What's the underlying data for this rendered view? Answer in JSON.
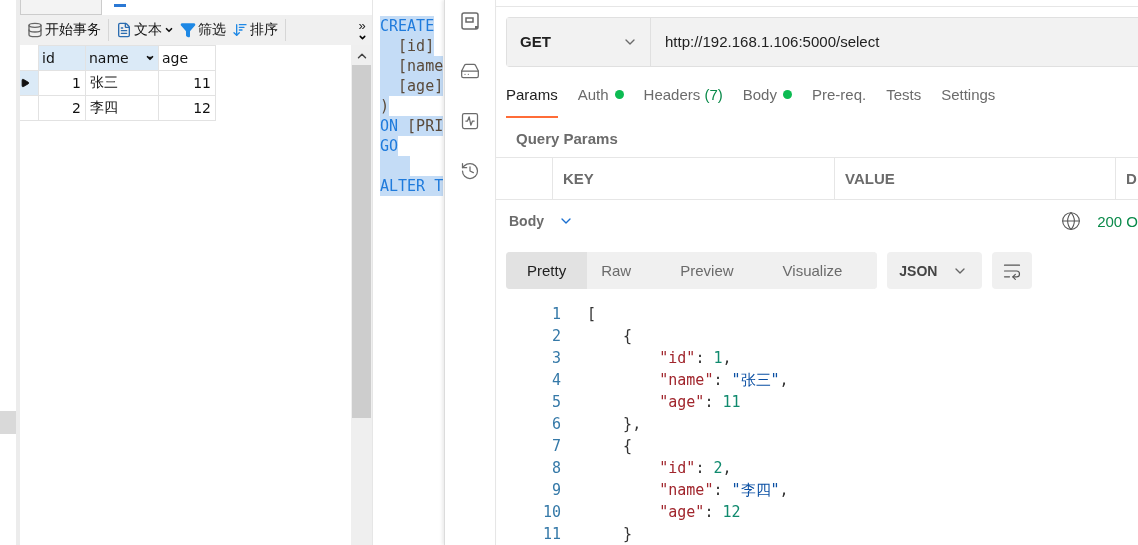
{
  "db_grid": {
    "toolbar": [
      {
        "label": "开始事务",
        "kind": "button"
      },
      {
        "label": "文本",
        "kind": "dropdown"
      },
      {
        "label": "筛选",
        "kind": "button"
      },
      {
        "label": "排序",
        "kind": "button"
      }
    ],
    "overflow": "»",
    "columns": [
      {
        "label": "id",
        "selected": true,
        "menu": false
      },
      {
        "label": "name",
        "selected": true,
        "menu": true
      },
      {
        "label": "age",
        "selected": false,
        "menu": false
      }
    ],
    "rows": [
      {
        "selected": true,
        "cells": [
          "1",
          "张三",
          "11"
        ]
      },
      {
        "selected": false,
        "cells": [
          "2",
          "李四",
          "12"
        ]
      }
    ]
  },
  "sql_editor": {
    "lines": [
      {
        "tokens": [
          {
            "kind": "keyword",
            "text": "CREATE"
          }
        ]
      },
      {
        "tokens": [
          {
            "kind": "plain",
            "text": "  [id]"
          }
        ]
      },
      {
        "tokens": [
          {
            "kind": "plain",
            "text": "  [name"
          }
        ]
      },
      {
        "tokens": [
          {
            "kind": "plain",
            "text": "  [age]"
          }
        ]
      },
      {
        "tokens": [
          {
            "kind": "plain",
            "text": ")"
          }
        ]
      },
      {
        "tokens": [
          {
            "kind": "keyword",
            "text": "ON"
          },
          {
            "kind": "plain",
            "text": " [PRI"
          }
        ]
      },
      {
        "tokens": [
          {
            "kind": "keyword",
            "text": "GO"
          }
        ]
      },
      {
        "kind": "blank"
      },
      {
        "tokens": [
          {
            "kind": "keyword",
            "text": "ALTER T"
          }
        ]
      }
    ]
  },
  "request": {
    "method": "GET",
    "url": "http://192.168.1.106:5000/select"
  },
  "tabs": [
    {
      "label": "Params",
      "selected": true,
      "dot": false
    },
    {
      "label": "Auth",
      "selected": false,
      "dot": true
    },
    {
      "label": "Headers",
      "count": "(7)",
      "selected": false,
      "dot": false
    },
    {
      "label": "Body",
      "selected": false,
      "dot": true
    },
    {
      "label": "Pre-req.",
      "selected": false,
      "dot": false
    },
    {
      "label": "Tests",
      "selected": false,
      "dot": false
    },
    {
      "label": "Settings",
      "selected": false,
      "dot": false
    }
  ],
  "query_params": {
    "title": "Query Params",
    "columns": [
      "KEY",
      "VALUE",
      "D"
    ]
  },
  "response": {
    "label": "Body",
    "status": "200 O",
    "views": [
      {
        "label": "Pretty",
        "selected": true
      },
      {
        "label": "Raw",
        "selected": false
      },
      {
        "label": "Preview",
        "selected": false
      },
      {
        "label": "Visualize",
        "selected": false
      }
    ],
    "format": "JSON",
    "lines": [
      {
        "number": "1",
        "tokens": [
          {
            "kind": "punct",
            "text": "["
          }
        ]
      },
      {
        "number": "2",
        "tokens": [
          {
            "kind": "punct",
            "text": "    {"
          }
        ]
      },
      {
        "number": "3",
        "tokens": [
          {
            "kind": "key",
            "text": "        \"id\""
          },
          {
            "kind": "punct",
            "text": ": "
          },
          {
            "kind": "number",
            "text": "1"
          },
          {
            "kind": "punct",
            "text": ","
          }
        ]
      },
      {
        "number": "4",
        "tokens": [
          {
            "kind": "key",
            "text": "        \"name\""
          },
          {
            "kind": "punct",
            "text": ": "
          },
          {
            "kind": "string",
            "text": "\"张三\""
          },
          {
            "kind": "punct",
            "text": ","
          }
        ]
      },
      {
        "number": "5",
        "tokens": [
          {
            "kind": "key",
            "text": "        \"age\""
          },
          {
            "kind": "punct",
            "text": ": "
          },
          {
            "kind": "number",
            "text": "11"
          }
        ]
      },
      {
        "number": "6",
        "tokens": [
          {
            "kind": "punct",
            "text": "    },"
          }
        ]
      },
      {
        "number": "7",
        "tokens": [
          {
            "kind": "punct",
            "text": "    {"
          }
        ]
      },
      {
        "number": "8",
        "tokens": [
          {
            "kind": "key",
            "text": "        \"id\""
          },
          {
            "kind": "punct",
            "text": ": "
          },
          {
            "kind": "number",
            "text": "2"
          },
          {
            "kind": "punct",
            "text": ","
          }
        ]
      },
      {
        "number": "9",
        "tokens": [
          {
            "kind": "key",
            "text": "        \"name\""
          },
          {
            "kind": "punct",
            "text": ": "
          },
          {
            "kind": "string",
            "text": "\"李四\""
          },
          {
            "kind": "punct",
            "text": ","
          }
        ]
      },
      {
        "number": "10",
        "tokens": [
          {
            "kind": "key",
            "text": "        \"age\""
          },
          {
            "kind": "punct",
            "text": ": "
          },
          {
            "kind": "number",
            "text": "12"
          }
        ]
      },
      {
        "number": "11",
        "tokens": [
          {
            "kind": "punct",
            "text": "    }"
          }
        ]
      }
    ]
  }
}
